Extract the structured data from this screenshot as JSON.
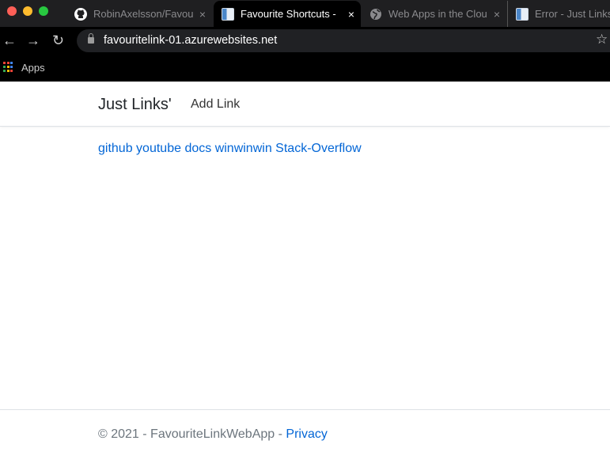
{
  "browser": {
    "tabs": [
      {
        "title": "RobinAxelsson/Favou",
        "icon": "github-icon",
        "active": false
      },
      {
        "title": "Favourite Shortcuts -",
        "icon": "document-icon",
        "active": true
      },
      {
        "title": "Web Apps in the Clou",
        "icon": "globe-icon",
        "active": false
      },
      {
        "title": "Error - Just Links",
        "icon": "document-icon",
        "active": false
      }
    ],
    "close_glyph": "×",
    "url": "favouritelink-01.azurewebsites.net",
    "bookmarks": [
      {
        "label": "Apps",
        "icon": "apps-grid-icon"
      }
    ]
  },
  "header": {
    "brand": "Just Links'",
    "nav": [
      {
        "label": "Add Link"
      }
    ]
  },
  "main": {
    "links": [
      "github",
      "youtube",
      "docs",
      "winwinwin",
      "Stack-Overflow"
    ]
  },
  "footer": {
    "text": "© 2021 - FavouriteLinkWebApp - ",
    "privacy": "Privacy"
  },
  "colors": {
    "link": "#0366d6",
    "chrome": "#000000"
  }
}
